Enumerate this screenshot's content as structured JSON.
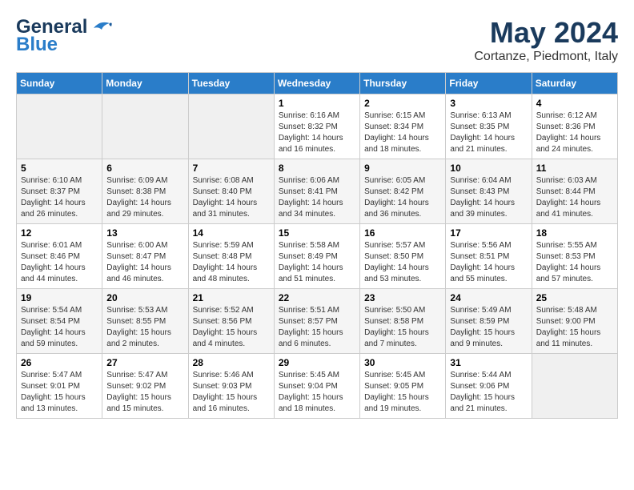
{
  "header": {
    "logo_line1": "General",
    "logo_line2": "Blue",
    "month_year": "May 2024",
    "location": "Cortanze, Piedmont, Italy"
  },
  "weekdays": [
    "Sunday",
    "Monday",
    "Tuesday",
    "Wednesday",
    "Thursday",
    "Friday",
    "Saturday"
  ],
  "weeks": [
    [
      {
        "day": "",
        "info": ""
      },
      {
        "day": "",
        "info": ""
      },
      {
        "day": "",
        "info": ""
      },
      {
        "day": "1",
        "info": "Sunrise: 6:16 AM\nSunset: 8:32 PM\nDaylight: 14 hours\nand 16 minutes."
      },
      {
        "day": "2",
        "info": "Sunrise: 6:15 AM\nSunset: 8:34 PM\nDaylight: 14 hours\nand 18 minutes."
      },
      {
        "day": "3",
        "info": "Sunrise: 6:13 AM\nSunset: 8:35 PM\nDaylight: 14 hours\nand 21 minutes."
      },
      {
        "day": "4",
        "info": "Sunrise: 6:12 AM\nSunset: 8:36 PM\nDaylight: 14 hours\nand 24 minutes."
      }
    ],
    [
      {
        "day": "5",
        "info": "Sunrise: 6:10 AM\nSunset: 8:37 PM\nDaylight: 14 hours\nand 26 minutes."
      },
      {
        "day": "6",
        "info": "Sunrise: 6:09 AM\nSunset: 8:38 PM\nDaylight: 14 hours\nand 29 minutes."
      },
      {
        "day": "7",
        "info": "Sunrise: 6:08 AM\nSunset: 8:40 PM\nDaylight: 14 hours\nand 31 minutes."
      },
      {
        "day": "8",
        "info": "Sunrise: 6:06 AM\nSunset: 8:41 PM\nDaylight: 14 hours\nand 34 minutes."
      },
      {
        "day": "9",
        "info": "Sunrise: 6:05 AM\nSunset: 8:42 PM\nDaylight: 14 hours\nand 36 minutes."
      },
      {
        "day": "10",
        "info": "Sunrise: 6:04 AM\nSunset: 8:43 PM\nDaylight: 14 hours\nand 39 minutes."
      },
      {
        "day": "11",
        "info": "Sunrise: 6:03 AM\nSunset: 8:44 PM\nDaylight: 14 hours\nand 41 minutes."
      }
    ],
    [
      {
        "day": "12",
        "info": "Sunrise: 6:01 AM\nSunset: 8:46 PM\nDaylight: 14 hours\nand 44 minutes."
      },
      {
        "day": "13",
        "info": "Sunrise: 6:00 AM\nSunset: 8:47 PM\nDaylight: 14 hours\nand 46 minutes."
      },
      {
        "day": "14",
        "info": "Sunrise: 5:59 AM\nSunset: 8:48 PM\nDaylight: 14 hours\nand 48 minutes."
      },
      {
        "day": "15",
        "info": "Sunrise: 5:58 AM\nSunset: 8:49 PM\nDaylight: 14 hours\nand 51 minutes."
      },
      {
        "day": "16",
        "info": "Sunrise: 5:57 AM\nSunset: 8:50 PM\nDaylight: 14 hours\nand 53 minutes."
      },
      {
        "day": "17",
        "info": "Sunrise: 5:56 AM\nSunset: 8:51 PM\nDaylight: 14 hours\nand 55 minutes."
      },
      {
        "day": "18",
        "info": "Sunrise: 5:55 AM\nSunset: 8:53 PM\nDaylight: 14 hours\nand 57 minutes."
      }
    ],
    [
      {
        "day": "19",
        "info": "Sunrise: 5:54 AM\nSunset: 8:54 PM\nDaylight: 14 hours\nand 59 minutes."
      },
      {
        "day": "20",
        "info": "Sunrise: 5:53 AM\nSunset: 8:55 PM\nDaylight: 15 hours\nand 2 minutes."
      },
      {
        "day": "21",
        "info": "Sunrise: 5:52 AM\nSunset: 8:56 PM\nDaylight: 15 hours\nand 4 minutes."
      },
      {
        "day": "22",
        "info": "Sunrise: 5:51 AM\nSunset: 8:57 PM\nDaylight: 15 hours\nand 6 minutes."
      },
      {
        "day": "23",
        "info": "Sunrise: 5:50 AM\nSunset: 8:58 PM\nDaylight: 15 hours\nand 7 minutes."
      },
      {
        "day": "24",
        "info": "Sunrise: 5:49 AM\nSunset: 8:59 PM\nDaylight: 15 hours\nand 9 minutes."
      },
      {
        "day": "25",
        "info": "Sunrise: 5:48 AM\nSunset: 9:00 PM\nDaylight: 15 hours\nand 11 minutes."
      }
    ],
    [
      {
        "day": "26",
        "info": "Sunrise: 5:47 AM\nSunset: 9:01 PM\nDaylight: 15 hours\nand 13 minutes."
      },
      {
        "day": "27",
        "info": "Sunrise: 5:47 AM\nSunset: 9:02 PM\nDaylight: 15 hours\nand 15 minutes."
      },
      {
        "day": "28",
        "info": "Sunrise: 5:46 AM\nSunset: 9:03 PM\nDaylight: 15 hours\nand 16 minutes."
      },
      {
        "day": "29",
        "info": "Sunrise: 5:45 AM\nSunset: 9:04 PM\nDaylight: 15 hours\nand 18 minutes."
      },
      {
        "day": "30",
        "info": "Sunrise: 5:45 AM\nSunset: 9:05 PM\nDaylight: 15 hours\nand 19 minutes."
      },
      {
        "day": "31",
        "info": "Sunrise: 5:44 AM\nSunset: 9:06 PM\nDaylight: 15 hours\nand 21 minutes."
      },
      {
        "day": "",
        "info": ""
      }
    ]
  ]
}
